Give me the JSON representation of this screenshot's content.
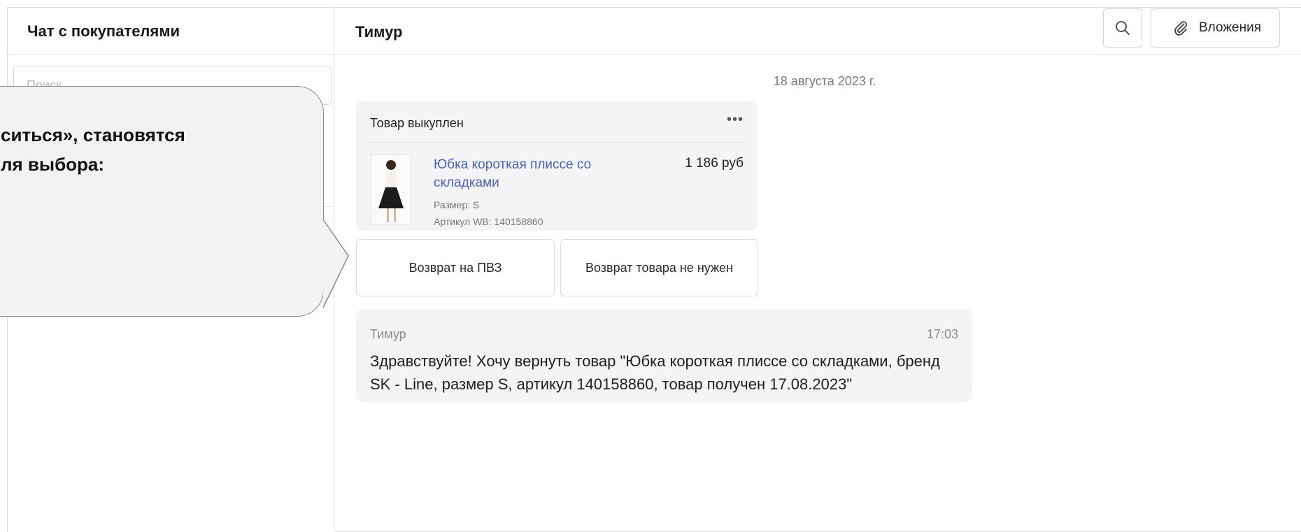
{
  "sidebar": {
    "title": "Чат с покупателями",
    "search_placeholder": "Поиск"
  },
  "callout": {
    "line1": "ситься», становятся",
    "line2": "ля выбора:"
  },
  "chat": {
    "title": "Тимур",
    "attach_label": "Вложения",
    "date": "18 августа 2023 г."
  },
  "product_card": {
    "status": "Товар выкуплен",
    "more": "•••",
    "name": "Юбка короткая плиссе со складками",
    "price": "1 186 руб",
    "size": "Размер: S",
    "article": "Артикул WB: 140158860"
  },
  "actions": {
    "return_pvz": "Возврат на ПВЗ",
    "return_not_needed": "Возврат товара не нужен"
  },
  "message": {
    "author": "Тимур",
    "time": "17:03",
    "text": "Здравствуйте! Хочу вернуть товар \"Юбка короткая плиссе со складками, бренд SK - Line, размер S, артикул 140158860, товар получен 17.08.2023\""
  },
  "colors": {
    "link": "#4a62c0",
    "bubble_bg": "#f4f4f6",
    "callout_bg": "#f2f2f2"
  }
}
